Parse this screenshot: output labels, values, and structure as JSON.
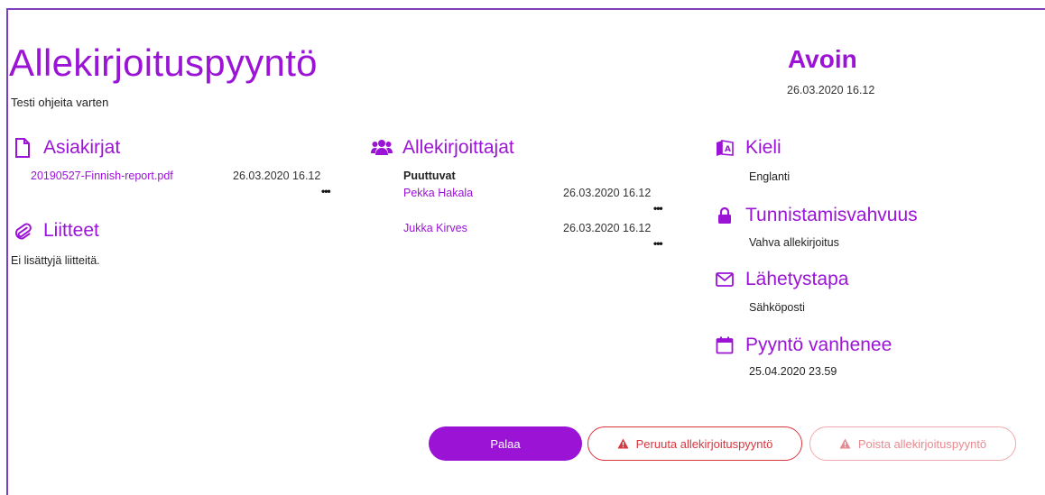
{
  "header": {
    "title": "Allekirjoituspyyntö",
    "subtitle": "Testi ohjeita varten",
    "status": "Avoin",
    "status_date": "26.03.2020 16.12"
  },
  "documents": {
    "heading": "Asiakirjat",
    "items": [
      {
        "name": "20190527-Finnish-report.pdf",
        "date": "26.03.2020 16.12"
      }
    ]
  },
  "attachments": {
    "heading": "Liitteet",
    "empty_text": "Ei lisättyjä liitteitä."
  },
  "signers": {
    "heading": "Allekirjoittajat",
    "group_label": "Puuttuvat",
    "items": [
      {
        "name": "Pekka Hakala",
        "date": "26.03.2020 16.12"
      },
      {
        "name": "Jukka Kirves",
        "date": "26.03.2020 16.12"
      }
    ]
  },
  "details": {
    "language": {
      "heading": "Kieli",
      "value": "Englanti"
    },
    "auth": {
      "heading": "Tunnistamisvahvuus",
      "value": "Vahva allekirjoitus"
    },
    "delivery": {
      "heading": "Lähetystapa",
      "value": "Sähköposti"
    },
    "expiry": {
      "heading": "Pyyntö vanhenee",
      "value": "25.04.2020 23.59"
    }
  },
  "actions": {
    "back": "Palaa",
    "cancel": "Peruuta allekirjoituspyyntö",
    "delete": "Poista allekirjoituspyyntö"
  },
  "more_label": "•••",
  "colors": {
    "accent": "#9b14d6",
    "danger": "#d9363e",
    "danger_light": "#f0a9ad",
    "frame": "#7b3fbf"
  }
}
